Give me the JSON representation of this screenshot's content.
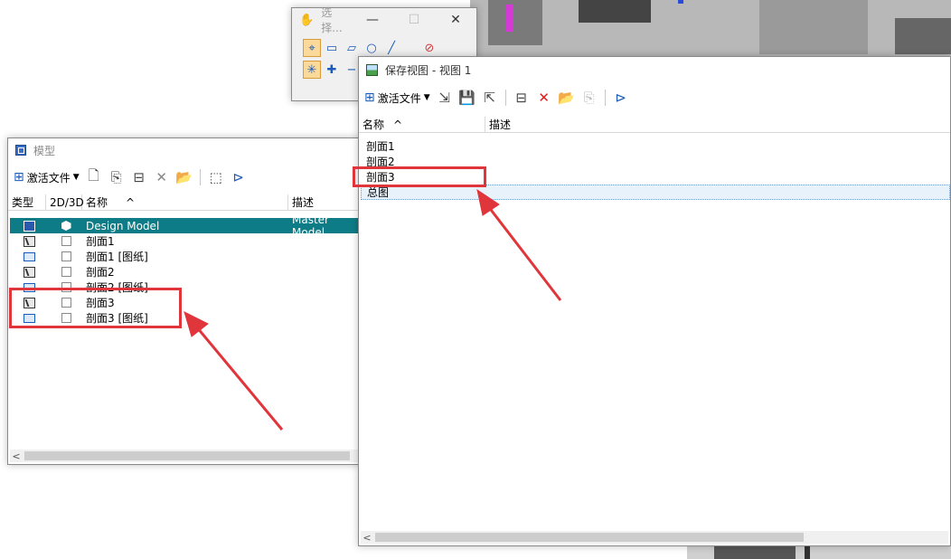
{
  "select_window": {
    "title": "选择...",
    "min": "—",
    "max": "☐",
    "close": "✕"
  },
  "model_window": {
    "title": "模型",
    "toolbar": {
      "activate_label": "激活文件"
    },
    "columns": {
      "type": "类型",
      "dim": "2D/3D",
      "name": "名称",
      "desc": "描述"
    },
    "rows": [
      {
        "name": "Design Model",
        "desc": "Master Model",
        "kind": "design",
        "selected": true
      },
      {
        "name": "剖面1",
        "desc": "",
        "kind": "section"
      },
      {
        "name": "剖面1 [图纸]",
        "desc": "",
        "kind": "sheet"
      },
      {
        "name": "剖面2",
        "desc": "",
        "kind": "section"
      },
      {
        "name": "剖面2 [图纸]",
        "desc": "",
        "kind": "sheet"
      },
      {
        "name": "剖面3",
        "desc": "",
        "kind": "section"
      },
      {
        "name": "剖面3 [图纸]",
        "desc": "",
        "kind": "sheet"
      }
    ]
  },
  "saved_view_window": {
    "title": "保存视图 - 视图 1",
    "toolbar": {
      "activate_label": "激活文件"
    },
    "columns": {
      "name": "名称",
      "desc": "描述"
    },
    "rows": [
      {
        "name": "剖面1"
      },
      {
        "name": "剖面2"
      },
      {
        "name": "剖面3"
      },
      {
        "name": "总图"
      }
    ]
  },
  "colors": {
    "selection": "#0e7c86",
    "annotation": "#e0353b"
  }
}
